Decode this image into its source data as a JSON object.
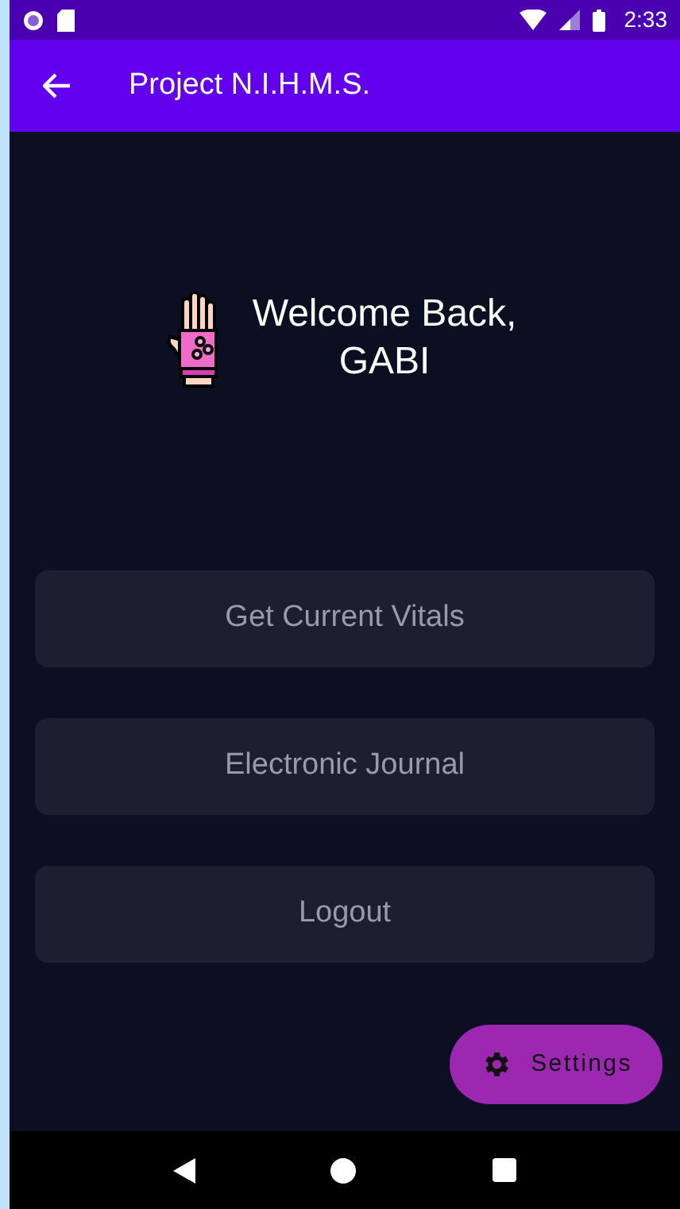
{
  "status_bar": {
    "time": "2:33"
  },
  "app_bar": {
    "title": "Project N.I.H.M.S."
  },
  "welcome": {
    "lines": [
      "Welcome Back,",
      "GABI"
    ]
  },
  "buttons": [
    {
      "label": "Get Current Vitals"
    },
    {
      "label": "Electronic Journal"
    },
    {
      "label": "Logout"
    }
  ],
  "fab": {
    "label": "Settings"
  }
}
